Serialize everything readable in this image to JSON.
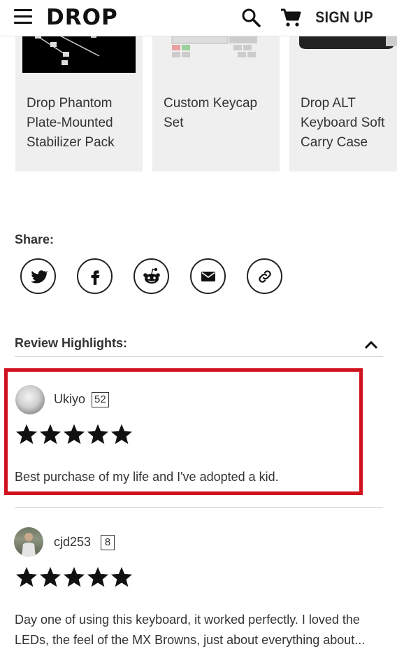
{
  "header": {
    "logo": "DROP",
    "signup_label": "SIGN UP"
  },
  "products": [
    {
      "name": "Drop Phantom Plate-Mounted Stabilizer Pack",
      "thumb": "stabilizer-photo"
    },
    {
      "name": "Custom Keycap Set",
      "thumb": "keycap-photo"
    },
    {
      "name": "Drop ALT Keyboard Soft Carry Case",
      "thumb": "carry-case-photo"
    }
  ],
  "share": {
    "label": "Share:",
    "buttons": [
      "twitter-icon",
      "facebook-icon",
      "reddit-icon",
      "email-icon",
      "link-icon"
    ]
  },
  "review_highlights": {
    "title": "Review Highlights:",
    "toggle_icon": "chevron-up-icon",
    "reviews": [
      {
        "username": "Ukiyo",
        "badge": "52",
        "rating": 5,
        "text": "Best purchase of my life and I've adopted a kid."
      },
      {
        "username": "cjd253",
        "badge": "8",
        "rating": 5,
        "text": "Day one of using this keyboard, it worked perfectly. I loved the LEDs, the feel of the MX Browns, just about everything about..."
      }
    ]
  },
  "colors": {
    "highlight_border": "#d0121f",
    "card_background": "#efefef",
    "text": "#333333"
  }
}
